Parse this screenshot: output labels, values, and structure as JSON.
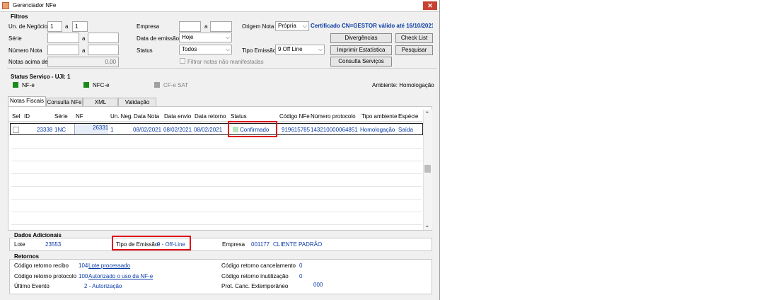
{
  "window": {
    "title": "Gerenciador NFe",
    "close": "✕"
  },
  "filters": {
    "heading": "Filtros",
    "un_negocio": {
      "label": "Un. de Negócio",
      "from": "1",
      "sep": "a",
      "to": "1"
    },
    "serie": {
      "label": "Série",
      "from": "",
      "sep": "a",
      "to": ""
    },
    "numero_nota": {
      "label": "Número Nota",
      "from": "",
      "sep": "a",
      "to": ""
    },
    "notas_acima": {
      "label": "Notas acima de",
      "value": "0,00"
    },
    "empresa": {
      "label": "Empresa",
      "from": "",
      "sep": "a",
      "to": ""
    },
    "data_emissao": {
      "label": "Data de emissão",
      "value": "Hoje"
    },
    "status": {
      "label": "Status",
      "value": "Todos"
    },
    "filtrar_check": {
      "label": "Filtrar notas não manifestadas"
    },
    "origem_nota": {
      "label": "Origem Nota",
      "value": "Própria"
    },
    "tipo_emissao": {
      "label": "Tipo Emissão",
      "value": "9 Off Line"
    },
    "certificado": "Certificado CN=GESTOR válido até 16/10/2021",
    "buttons": {
      "divergencias": "Divergências",
      "check_list": "Check List",
      "imprimir": "Imprimir Estatística",
      "pesquisar": "Pesquisar",
      "consulta_servicos": "Consulta Serviços"
    }
  },
  "status_servico": {
    "heading": "Status Serviço - UJI: 1",
    "nfe": "NF-e",
    "nfce": "NFC-e",
    "cfe": "CF-e SAT",
    "ambiente": "Ambiente: Homologação",
    "colors": {
      "ok": "#1a8a1a",
      "off": "#a0a0a0"
    }
  },
  "tabs": [
    "Notas Fiscais",
    "Consulta NFe",
    "XML",
    "Validação XML"
  ],
  "table": {
    "headers": [
      "Sel",
      "ID",
      "Série",
      "NF",
      "Un. Neg.",
      "Data Nota",
      "Data envio",
      "Data retorno",
      "Status",
      "Código NFe",
      "Número protocolo",
      "Tipo ambiente",
      "Espécie"
    ],
    "row": {
      "id": "23338",
      "serie": "1NC",
      "nf": "26331",
      "un_neg": "1",
      "data_nota": "08/02/2021",
      "data_envio": "08/02/2021",
      "data_retorno": "08/02/2021",
      "status": "Confirmado",
      "codigo_nfe": "919615785",
      "protocolo": "143210000064851",
      "tipo_ambiente": "Homologação",
      "especie": "Saída"
    }
  },
  "dados_adicionais": {
    "heading": "Dados Adicionais",
    "lote_label": "Lote",
    "lote_value": "23553",
    "tipo_emissao_label": "Tipo de Emissão",
    "tipo_emissao_value": "9 - Off-Line",
    "empresa_label": "Empresa",
    "empresa_code": "001177",
    "empresa_name": "CLIENTE PADRÃO"
  },
  "retornos": {
    "heading": "Retornos",
    "recibo_label": "Código retorno recibo",
    "recibo_code": "104",
    "recibo_desc": "Lote processado",
    "protocolo_label": "Código retorno protocolo",
    "protocolo_code": "100",
    "protocolo_desc": "Autorizado o uso da NF-e",
    "evento_label": "Último Evento",
    "evento_value": "2 - Autorização",
    "cancelamento_label": "Código retorno cancelamento",
    "cancelamento_value": "0",
    "inutilizacao_label": "Código retorno inutilização",
    "inutilizacao_value": "0",
    "extemporaneo_label": "Prot. Canc. Extemporâneo",
    "extemporaneo_value": "000"
  },
  "accent_red": "#e0101a"
}
